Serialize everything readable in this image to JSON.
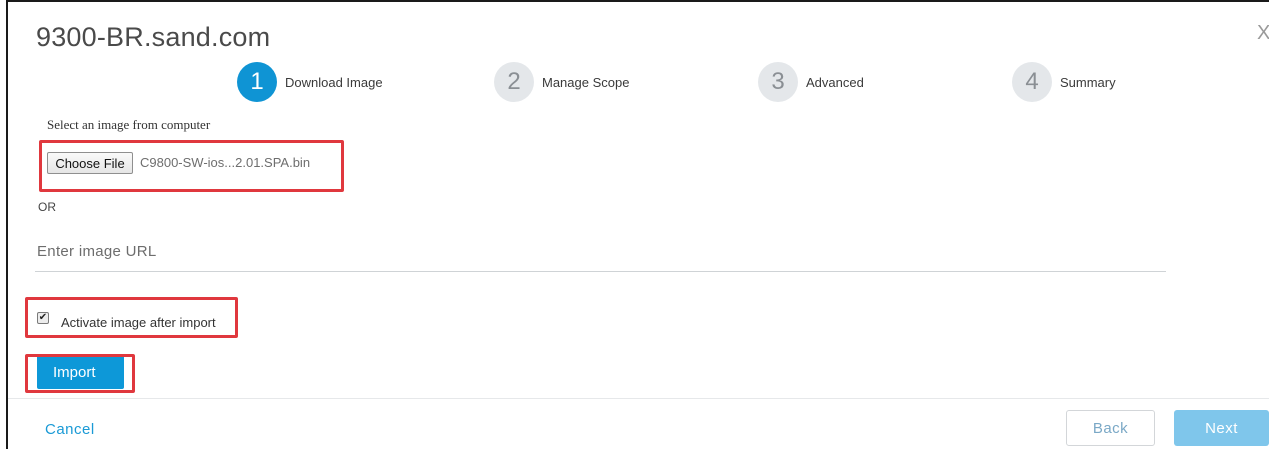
{
  "dialog": {
    "title": "9300-BR.sand.com",
    "close_glyph": "X"
  },
  "steps": [
    {
      "number": "1",
      "label": "Download Image",
      "active": true
    },
    {
      "number": "2",
      "label": "Manage Scope",
      "active": false
    },
    {
      "number": "3",
      "label": "Advanced",
      "active": false
    },
    {
      "number": "4",
      "label": "Summary",
      "active": false
    }
  ],
  "upload": {
    "select_label": "Select an image from computer",
    "choose_file_label": "Choose File",
    "file_name": "C9800-SW-ios...2.01.SPA.bin",
    "or_label": "OR",
    "url_placeholder": "Enter image URL"
  },
  "options": {
    "activate_label": "Activate image after import",
    "activate_checked": true,
    "check_glyph": "✔"
  },
  "actions": {
    "import_label": "Import",
    "cancel_label": "Cancel",
    "back_label": "Back",
    "next_label": "Next"
  },
  "colors": {
    "accent": "#0d98d8",
    "highlight": "#e0383e",
    "next_disabled": "#7fc6eb"
  }
}
